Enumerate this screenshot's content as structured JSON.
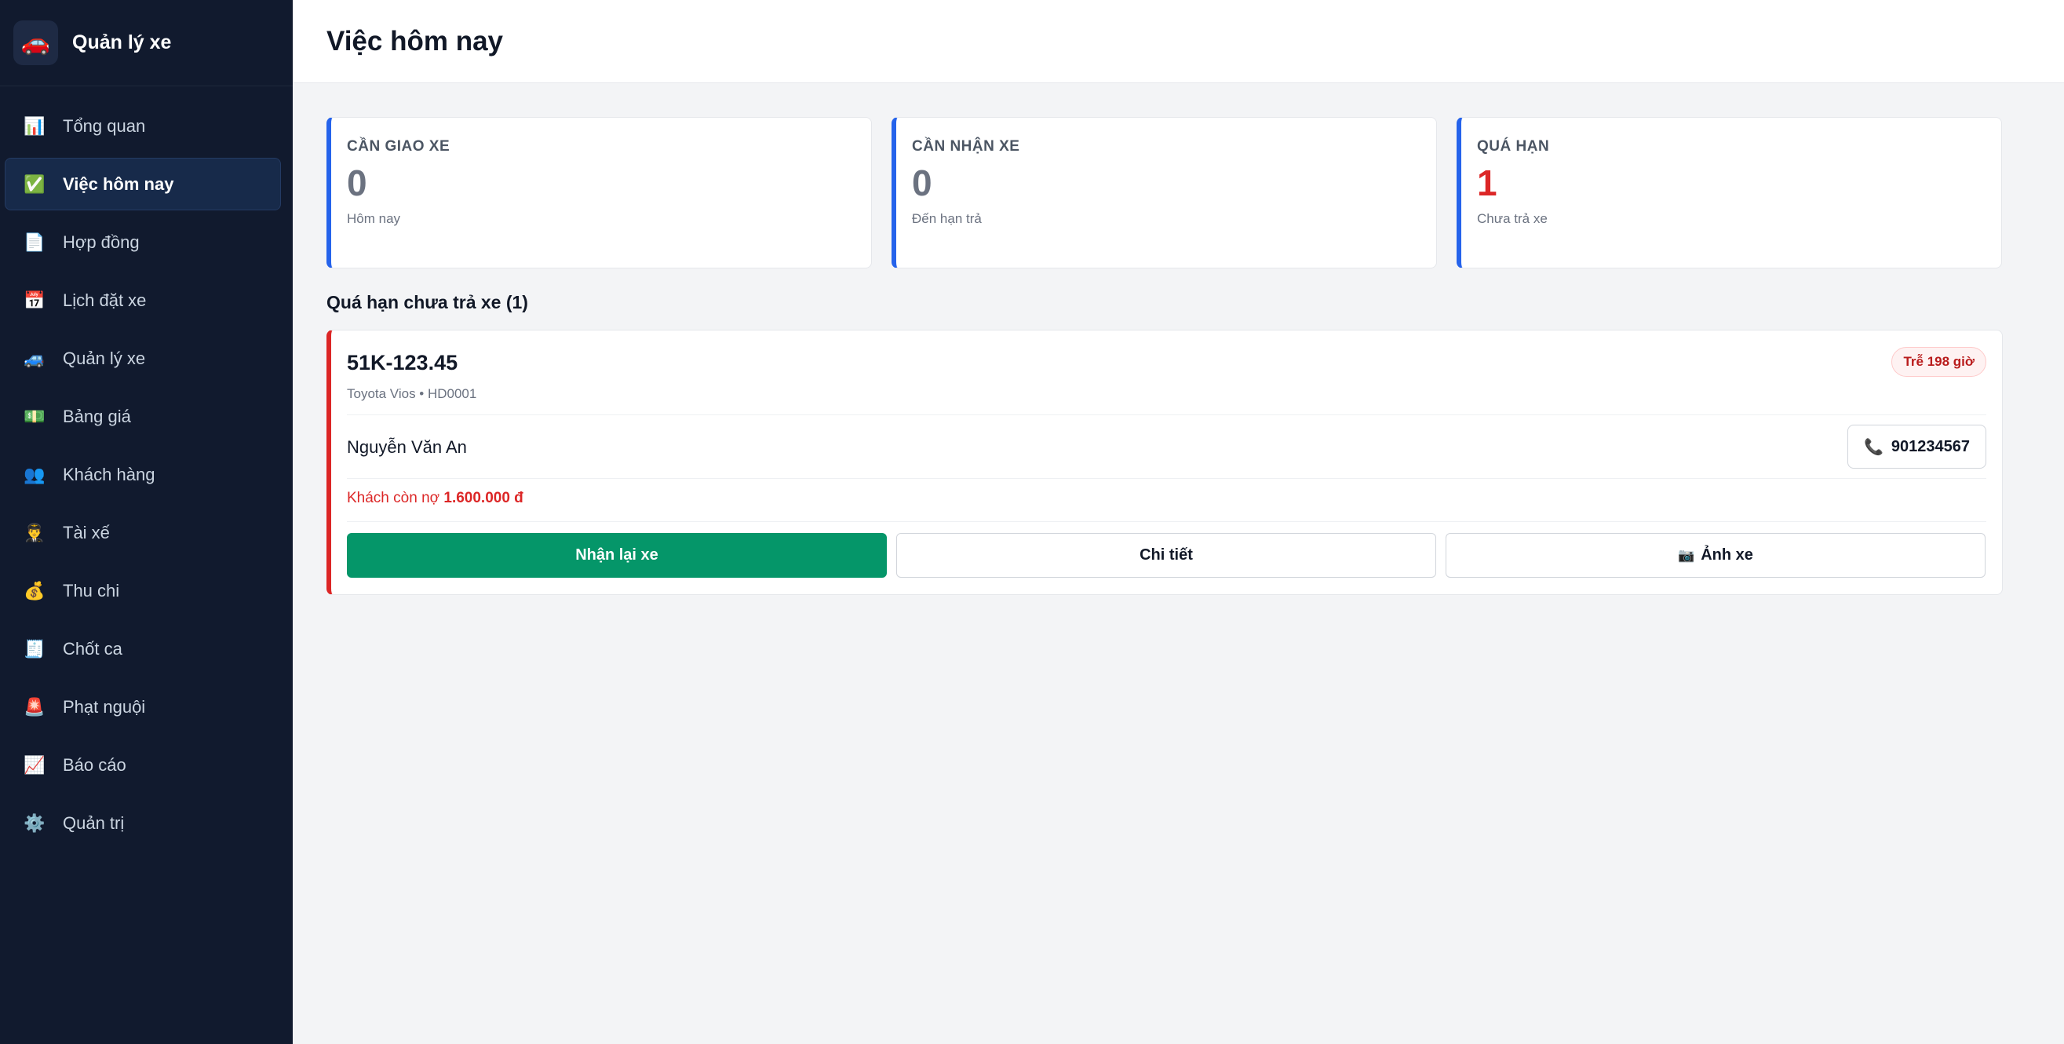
{
  "brand": {
    "title": "Quản lý xe",
    "icon": "car-icon"
  },
  "sidebar": {
    "items": [
      {
        "label": "Tổng quan",
        "icon": "chart-icon",
        "glyph": "📊",
        "active": false
      },
      {
        "label": "Việc hôm nay",
        "icon": "check-icon",
        "glyph": "✅",
        "active": true
      },
      {
        "label": "Hợp đồng",
        "icon": "document-icon",
        "glyph": "📄",
        "active": false
      },
      {
        "label": "Lịch đặt xe",
        "icon": "calendar-icon",
        "glyph": "📅",
        "active": false
      },
      {
        "label": "Quản lý xe",
        "icon": "car-icon",
        "glyph": "🚙",
        "active": false
      },
      {
        "label": "Bảng giá",
        "icon": "money-icon",
        "glyph": "💵",
        "active": false
      },
      {
        "label": "Khách hàng",
        "icon": "users-icon",
        "glyph": "👥",
        "active": false
      },
      {
        "label": "Tài xế",
        "icon": "driver-icon",
        "glyph": "👨‍✈️",
        "active": false
      },
      {
        "label": "Thu chi",
        "icon": "money-bag-icon",
        "glyph": "💰",
        "active": false
      },
      {
        "label": "Chốt ca",
        "icon": "receipt-icon",
        "glyph": "🧾",
        "active": false
      },
      {
        "label": "Phạt nguội",
        "icon": "siren-icon",
        "glyph": "🚨",
        "active": false
      },
      {
        "label": "Báo cáo",
        "icon": "trend-icon",
        "glyph": "📈",
        "active": false
      },
      {
        "label": "Quản trị",
        "icon": "gear-icon",
        "glyph": "⚙️",
        "active": false
      }
    ]
  },
  "header": {
    "title": "Việc hôm nay"
  },
  "stats": [
    {
      "label": "Cần giao xe",
      "value": "0",
      "sub": "Hôm nay"
    },
    {
      "label": "Cần nhận xe",
      "value": "0",
      "sub": "Đến hạn trả"
    },
    {
      "label": "Quá hạn",
      "value": "1",
      "sub": "Chưa trả xe"
    }
  ],
  "overdue": {
    "section_title": "Quá hạn chưa trả xe (1)",
    "plate": "51K-123.45",
    "car_meta": "Toyota Vios • HD0001",
    "late_badge": "Trễ 198 giờ",
    "customer": "Nguyễn Văn An",
    "phone": "901234567",
    "debt_label": "Khách còn nợ",
    "debt_amount": "1.600.000 đ",
    "btn_receive": "Nhận lại xe",
    "btn_detail": "Chi tiết",
    "btn_photos": "Ảnh xe"
  },
  "colors": {
    "sidebar_bg": "#111a2e",
    "accent_blue": "#2563eb",
    "danger": "#dc2626",
    "success": "#059669"
  }
}
